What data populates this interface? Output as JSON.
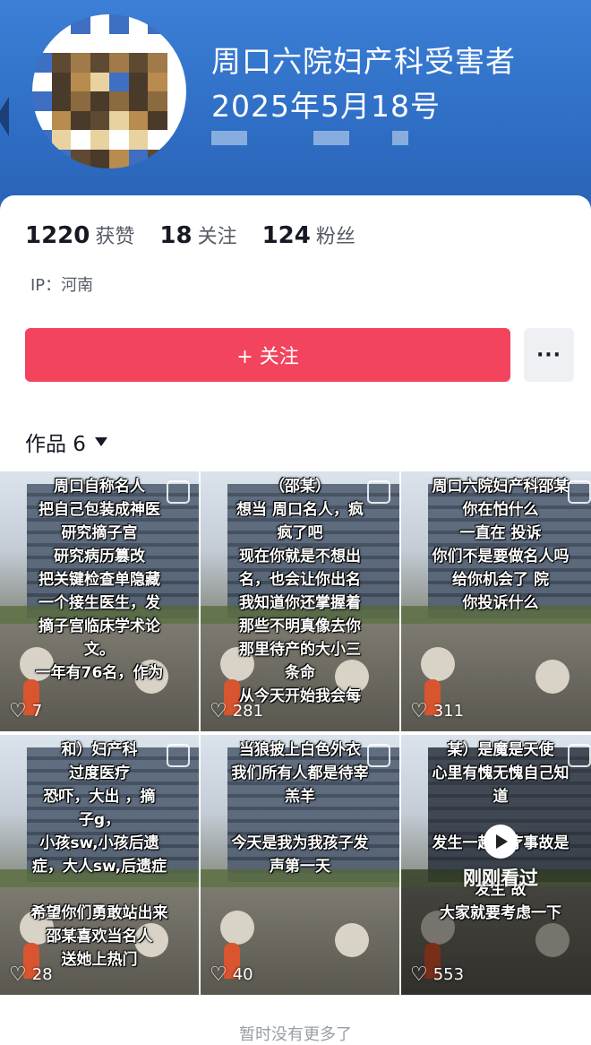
{
  "profile": {
    "title": "周口六院妇产科受害者",
    "date": "2025年5月18号"
  },
  "stats": [
    {
      "value": "1220",
      "label": "获赞"
    },
    {
      "value": "18",
      "label": "关注"
    },
    {
      "value": "124",
      "label": "粉丝"
    }
  ],
  "ip": "IP：河南",
  "follow_button": "+ 关注",
  "more_button": "···",
  "works_tab": "作品 6",
  "videos": [
    {
      "lines": [
        "周口自称名人",
        "把自己包装成神医",
        "研究摘子宫",
        "研究病历篡改",
        "把关键检查单隐藏",
        "一个接生医生，发",
        "摘子宫临床学术论",
        "文。",
        "一年有76名，作为"
      ],
      "likes": "7"
    },
    {
      "lines": [
        "（邵某）",
        "想当 周口名人，疯",
        "疯了吧",
        "现在你就是不想出",
        "名，也会让你出名",
        "我知道你还掌握着",
        "那些不明真像去你",
        "那里待产的大小三",
        "条命",
        "从今天开始我会每"
      ],
      "likes": "281"
    },
    {
      "lines": [
        "周口六院妇产科邵某",
        "你在怕什么",
        "一直在    投诉",
        "你们不是要做名人吗",
        "给你机会了  院",
        "你投诉什么"
      ],
      "likes": "311"
    },
    {
      "lines": [
        "和）妇产科",
        "过度医疗",
        "恐吓，大出   ，摘",
        "子g，",
        "小孩sw,小孩后遗",
        "症，大人sw,后遗症",
        "",
        "希望你们勇敢站出来",
        "邵某喜欢当名人",
        "送她上热门"
      ],
      "likes": "28"
    },
    {
      "lines": [
        "当狼披上白色外衣",
        "我们所有人都是待宰",
        "羔羊",
        "",
        "今天是我为我孩子发",
        "声第一天"
      ],
      "likes": "40"
    },
    {
      "lines": [
        "某）是魔是天使",
        "心里有愧无愧自己知",
        "道",
        "",
        "发生一起医疗事故是",
        "",
        "发生    故",
        "大家就要考虑一下"
      ],
      "likes": "553",
      "overlay": "刚刚看过"
    }
  ],
  "footer": "暂时没有更多了"
}
